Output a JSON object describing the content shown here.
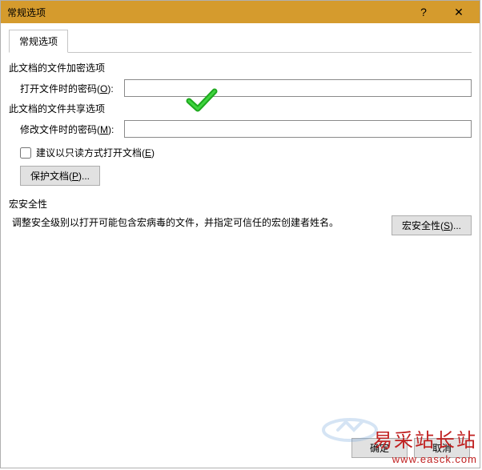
{
  "window": {
    "title": "常规选项",
    "help": "?",
    "close": "✕"
  },
  "tabs": {
    "general": "常规选项"
  },
  "encryption": {
    "section_label": "此文档的文件加密选项",
    "open_password_label": "打开文件时的密码(O):",
    "open_password_value": ""
  },
  "sharing": {
    "section_label": "此文档的文件共享选项",
    "modify_password_label": "修改文件时的密码(M):",
    "modify_password_value": "",
    "readonly_recommended_label": "建议以只读方式打开文档(E)",
    "readonly_recommended_checked": false,
    "protect_document_btn": "保护文档(P)..."
  },
  "macro": {
    "section_label": "宏安全性",
    "description": "调整安全级别以打开可能包含宏病毒的文件，并指定可信任的宏创建者姓名。",
    "macro_security_btn": "宏安全性(S)..."
  },
  "footer": {
    "ok": "确定",
    "cancel": "取消"
  },
  "watermark": {
    "text": "易采站长站",
    "url": "www.easck.com"
  }
}
